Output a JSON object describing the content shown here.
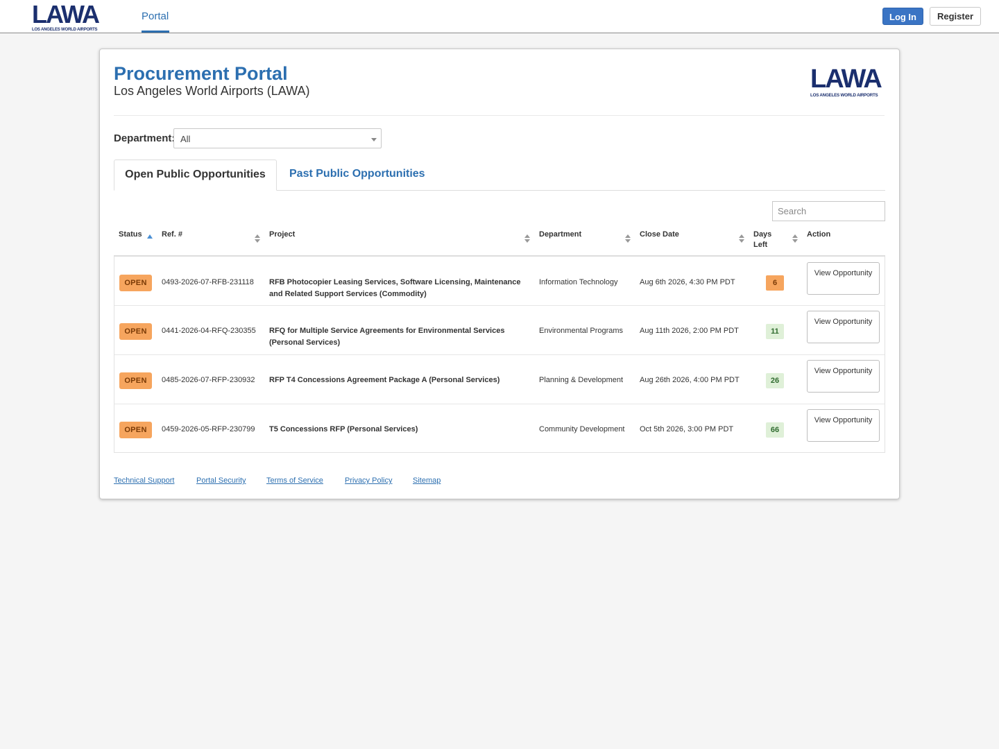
{
  "header": {
    "logo_word": "LAWA",
    "logo_sub": "LOS ANGELES WORLD AIRPORTS",
    "nav_portal": "Portal",
    "login_label": "Log In",
    "register_label": "Register"
  },
  "card": {
    "title": "Procurement Portal",
    "subtitle": "Los Angeles World Airports (LAWA)",
    "department_label": "Department:",
    "department_value": "All",
    "tab_open": "Open Public Opportunities",
    "tab_past": "Past Public Opportunities",
    "search_placeholder": "Search"
  },
  "table": {
    "headers": {
      "status": "Status",
      "ref": "Ref. #",
      "project": "Project",
      "department": "Department",
      "close_date": "Close Date",
      "days_left": "Days Left",
      "action": "Action"
    },
    "rows": [
      {
        "status": "OPEN",
        "ref": "0493-2026-07-RFB-231118",
        "project": "RFB Photocopier Leasing Services, Software Licensing, Maintenance and Related Support Services (Commodity)",
        "department": "Information Technology",
        "close_date": "Aug 6th 2026, 4:30 PM PDT",
        "days_left": "6",
        "action": "View Opportunity"
      },
      {
        "status": "OPEN",
        "ref": "0441-2026-04-RFQ-230355",
        "project": "RFQ for Multiple Service Agreements for Environmental Services (Personal Services)",
        "department": "Environmental Programs",
        "close_date": "Aug 11th 2026, 2:00 PM PDT",
        "days_left": "11",
        "action": "View Opportunity"
      },
      {
        "status": "OPEN",
        "ref": "0485-2026-07-RFP-230932",
        "project": "RFP T4 Concessions Agreement Package A (Personal Services)",
        "department": "Planning & Development",
        "close_date": "Aug 26th 2026, 4:00 PM PDT",
        "days_left": "26",
        "action": "View Opportunity"
      },
      {
        "status": "OPEN",
        "ref": "0459-2026-05-RFP-230799",
        "project": "T5 Concessions RFP (Personal Services)",
        "department": "Community Development",
        "close_date": "Oct 5th 2026, 3:00 PM PDT",
        "days_left": "66",
        "action": "View Opportunity"
      }
    ]
  },
  "footer": {
    "links": [
      "Technical Support",
      "Portal Security",
      "Terms of Service",
      "Privacy Policy",
      "Sitemap"
    ]
  },
  "colors": {
    "brand_blue": "#2c6fb0",
    "logo_navy": "#1b2f6e",
    "open_badge": "#f6a55e",
    "days_ok": "#dff0d8"
  }
}
